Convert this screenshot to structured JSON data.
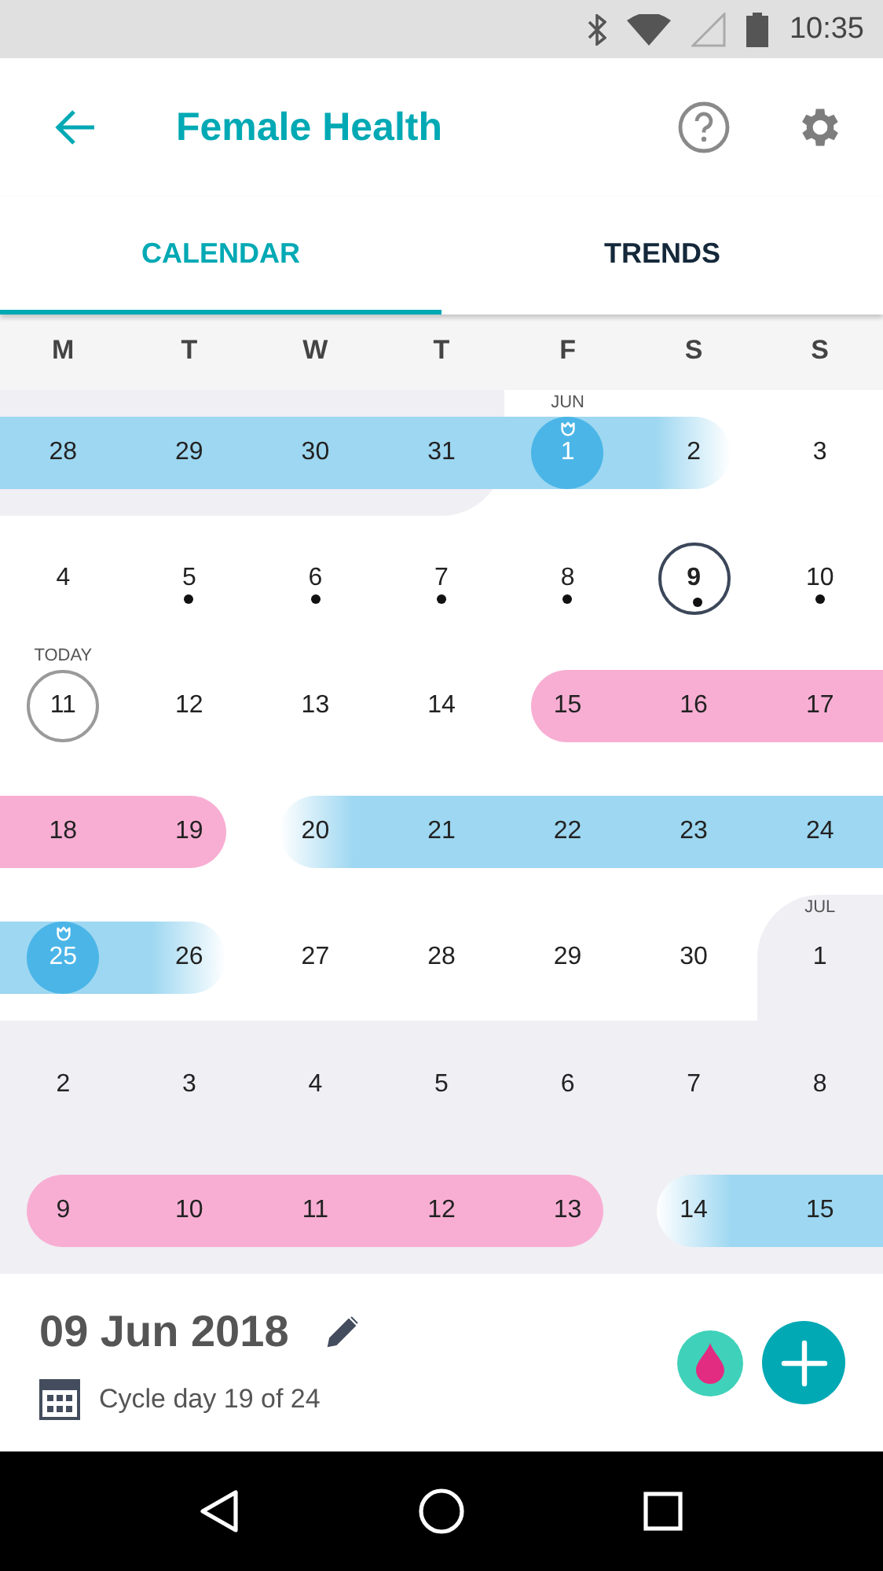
{
  "status_bar": {
    "time": "10:35"
  },
  "app_bar": {
    "title": "Female Health"
  },
  "tabs": [
    {
      "label": "CALENDAR",
      "selected": true
    },
    {
      "label": "TRENDS",
      "selected": false
    }
  ],
  "weekdays": [
    "M",
    "T",
    "W",
    "T",
    "F",
    "S",
    "S"
  ],
  "weeks": [
    [
      {
        "day": "28",
        "outside": true,
        "fertile": true
      },
      {
        "day": "29",
        "outside": true,
        "fertile": true
      },
      {
        "day": "30",
        "outside": true,
        "fertile": true
      },
      {
        "day": "31",
        "outside": true,
        "fertile": true
      },
      {
        "day": "1",
        "month": "JUN",
        "fertile": true,
        "ovulation": true
      },
      {
        "day": "2",
        "fertile": true,
        "band_end": true,
        "fade": true
      },
      {
        "day": "3"
      }
    ],
    [
      {
        "day": "4"
      },
      {
        "day": "5",
        "dot": true
      },
      {
        "day": "6",
        "dot": true
      },
      {
        "day": "7",
        "dot": true
      },
      {
        "day": "8",
        "dot": true
      },
      {
        "day": "9",
        "dot": true,
        "selected": true
      },
      {
        "day": "10",
        "dot": true
      }
    ],
    [
      {
        "day": "11",
        "today": true,
        "today_label": "TODAY"
      },
      {
        "day": "12"
      },
      {
        "day": "13"
      },
      {
        "day": "14"
      },
      {
        "day": "15",
        "period": true,
        "band_start": true
      },
      {
        "day": "16",
        "period": true
      },
      {
        "day": "17",
        "period": true
      }
    ],
    [
      {
        "day": "18",
        "period": true
      },
      {
        "day": "19",
        "period": true,
        "band_end": true
      },
      {
        "day": "20",
        "fertile": true,
        "band_start": true,
        "fade": true
      },
      {
        "day": "21",
        "fertile": true
      },
      {
        "day": "22",
        "fertile": true
      },
      {
        "day": "23",
        "fertile": true
      },
      {
        "day": "24",
        "fertile": true
      }
    ],
    [
      {
        "day": "25",
        "fertile": true,
        "ovulation": true
      },
      {
        "day": "26",
        "fertile": true,
        "band_end": true,
        "fade": true
      },
      {
        "day": "27"
      },
      {
        "day": "28"
      },
      {
        "day": "29"
      },
      {
        "day": "30"
      },
      {
        "day": "1",
        "month": "JUL",
        "outside": true
      }
    ],
    [
      {
        "day": "2",
        "outside": true
      },
      {
        "day": "3",
        "outside": true
      },
      {
        "day": "4",
        "outside": true
      },
      {
        "day": "5",
        "outside": true
      },
      {
        "day": "6",
        "outside": true
      },
      {
        "day": "7",
        "outside": true
      },
      {
        "day": "8",
        "outside": true
      }
    ],
    [
      {
        "day": "9",
        "outside": true,
        "period": true,
        "band_start": true
      },
      {
        "day": "10",
        "outside": true,
        "period": true
      },
      {
        "day": "11",
        "outside": true,
        "period": true
      },
      {
        "day": "12",
        "outside": true,
        "period": true
      },
      {
        "day": "13",
        "outside": true,
        "period": true,
        "band_end": true
      },
      {
        "day": "14",
        "outside": true,
        "fertile": true,
        "band_start": true,
        "fade": true
      },
      {
        "day": "15",
        "outside": true,
        "fertile": true
      }
    ]
  ],
  "summary": {
    "date": "09 Jun 2018",
    "cycle": "Cycle day 19 of 24"
  }
}
